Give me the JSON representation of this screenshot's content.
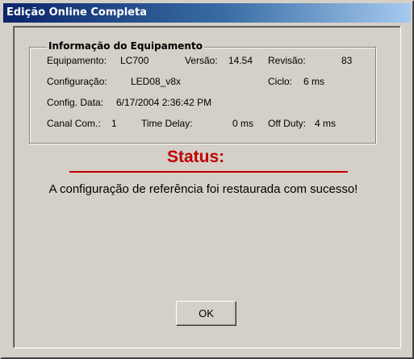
{
  "window": {
    "title": "Edição Online Completa"
  },
  "equipment_info": {
    "group_label": "Informação do Equipamento",
    "equipment_label": "Equipamento:",
    "equipment_value": "LC700",
    "version_label": "Versão:",
    "version_value": "14.54",
    "revision_label": "Revisão:",
    "revision_value": "83",
    "configuration_label": "Configuração:",
    "configuration_value": "LED08_v8x",
    "cycle_label": "Ciclo:",
    "cycle_value": "6 ms",
    "config_date_label": "Config. Data:",
    "config_date_value": "6/17/2004 2:36:42 PM",
    "channel_label": "Canal Com.:",
    "channel_value": "1",
    "time_delay_label": "Time Delay:",
    "time_delay_value": "0 ms",
    "off_duty_label": "Off Duty:",
    "off_duty_value": "4 ms"
  },
  "status": {
    "title": "Status:",
    "message": "A configuração de referência foi restaurada com sucesso!",
    "accent_color": "#c00000"
  },
  "buttons": {
    "ok_label": "OK"
  },
  "colors": {
    "dialog_bg": "#d4d0c8",
    "titlebar_start": "#0a246a",
    "titlebar_end": "#a6caf0"
  }
}
